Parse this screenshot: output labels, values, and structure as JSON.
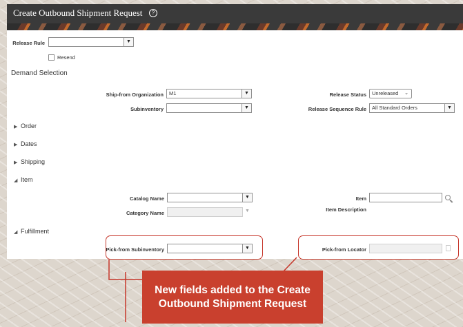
{
  "header": {
    "title": "Create Outbound Shipment Request",
    "help_icon": "?"
  },
  "release_rule": {
    "label": "Release Rule",
    "value": "",
    "resend_label": "Resend",
    "resend_checked": false
  },
  "demand_selection": {
    "title": "Demand Selection",
    "ship_from_org": {
      "label": "Ship-from Organization",
      "value": "M1"
    },
    "subinventory": {
      "label": "Subinventory",
      "value": ""
    },
    "release_status": {
      "label": "Release Status",
      "value": "Unreleased"
    },
    "release_sequence_rule": {
      "label": "Release Sequence Rule",
      "value": "All Standard Orders"
    }
  },
  "sections": {
    "order": "Order",
    "dates": "Dates",
    "shipping": "Shipping",
    "item": "Item",
    "fulfillment": "Fulfillment"
  },
  "item": {
    "catalog_name": {
      "label": "Catalog Name",
      "value": ""
    },
    "category_name": {
      "label": "Category Name",
      "value": ""
    },
    "item": {
      "label": "Item",
      "value": ""
    },
    "item_description": {
      "label": "Item Description"
    }
  },
  "fulfillment": {
    "pick_from_subinventory": {
      "label": "Pick-from Subinventory",
      "value": ""
    },
    "pick_from_locator": {
      "label": "Pick-from Locator",
      "value": ""
    }
  },
  "callout": {
    "text": "New fields added to the Create Outbound Shipment Request"
  },
  "colors": {
    "accent": "#c9402e",
    "header": "#3a3a3a"
  }
}
